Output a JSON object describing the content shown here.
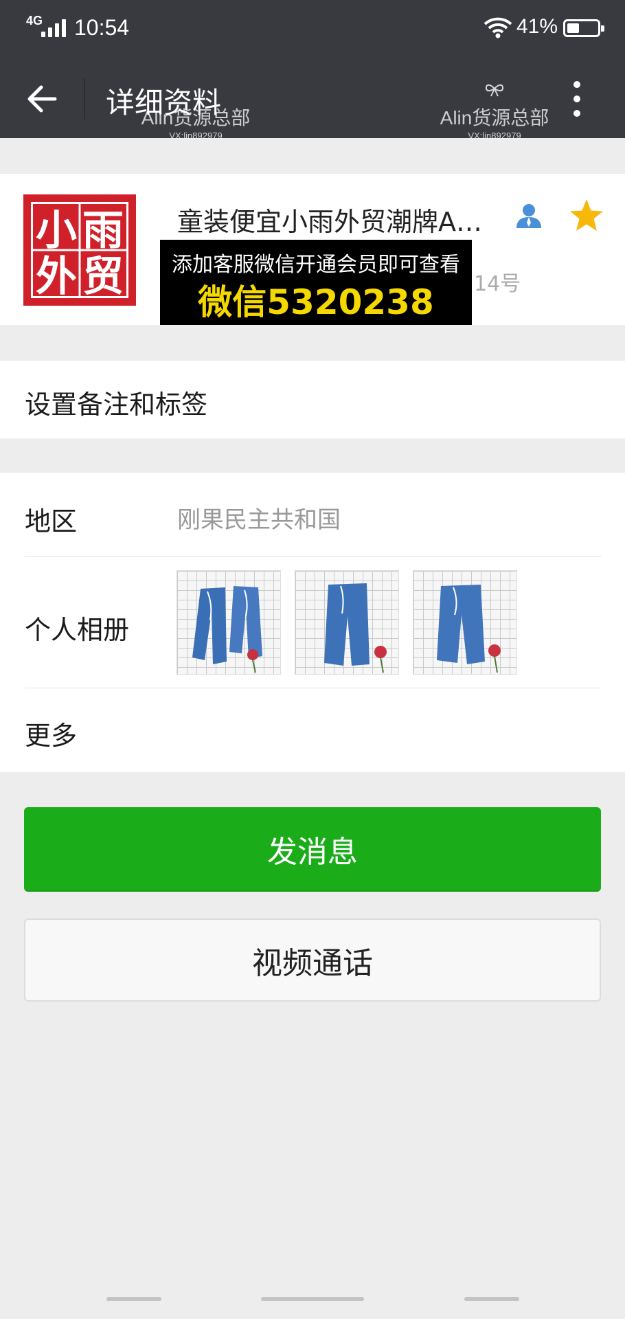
{
  "status_bar": {
    "network": "4G",
    "time": "10:54",
    "battery_percent": "41%",
    "battery_level": 0.41
  },
  "nav": {
    "title": "详细资料"
  },
  "watermarks": [
    {
      "brand": "Alin货源总部",
      "id": "VX:lin892979"
    },
    {
      "brand": "Alin货源总部",
      "id": "VX:lin892979"
    }
  ],
  "profile": {
    "logo_chars": [
      "小",
      "雨",
      "外",
      "贸"
    ],
    "name": "童装便宜小雨外贸潮牌A…",
    "account_id_partial": "14号",
    "favorite": true
  },
  "overlay_ad": {
    "line1": "添加客服微信开通会员即可查看",
    "line2": "微信5320238"
  },
  "remark": {
    "label": "设置备注和标签"
  },
  "info": {
    "region_label": "地区",
    "region_value": "刚果民主共和国",
    "album_label": "个人相册",
    "album_photo_count": 3,
    "more_label": "更多"
  },
  "actions": {
    "send_message": "发消息",
    "video_call": "视频通话"
  },
  "colors": {
    "nav_bg": "#393a3f",
    "primary_green": "#1aad19",
    "logo_red": "#d0212b",
    "ad_yellow": "#f5d800",
    "page_bg": "#ededed"
  }
}
